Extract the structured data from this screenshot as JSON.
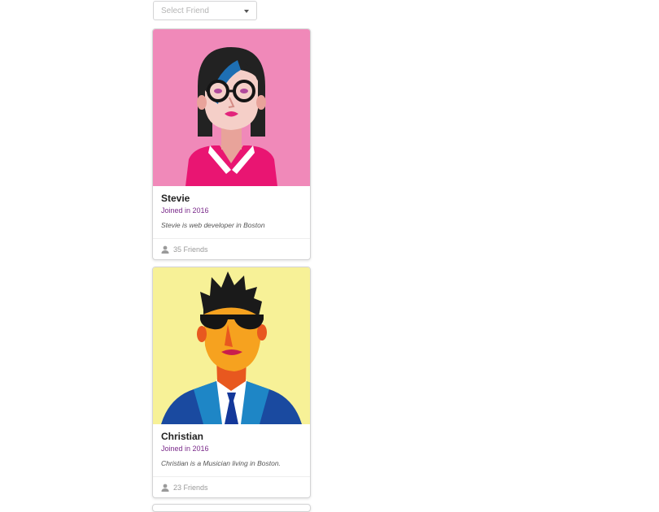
{
  "dropdown": {
    "placeholder": "Select Friend"
  },
  "cards": [
    {
      "name": "Stevie",
      "joined": "Joined in 2016",
      "description": "Stevie is web developer in Boston",
      "friends": "35 Friends",
      "bg_color": "#f089b9"
    },
    {
      "name": "Christian",
      "joined": "Joined in 2016",
      "description": "Christian is a Musician living in Boston.",
      "friends": "23 Friends",
      "bg_color": "#f7f197"
    }
  ],
  "colors": {
    "accent": "#7a2a8a",
    "muted": "#9a9a9a"
  }
}
